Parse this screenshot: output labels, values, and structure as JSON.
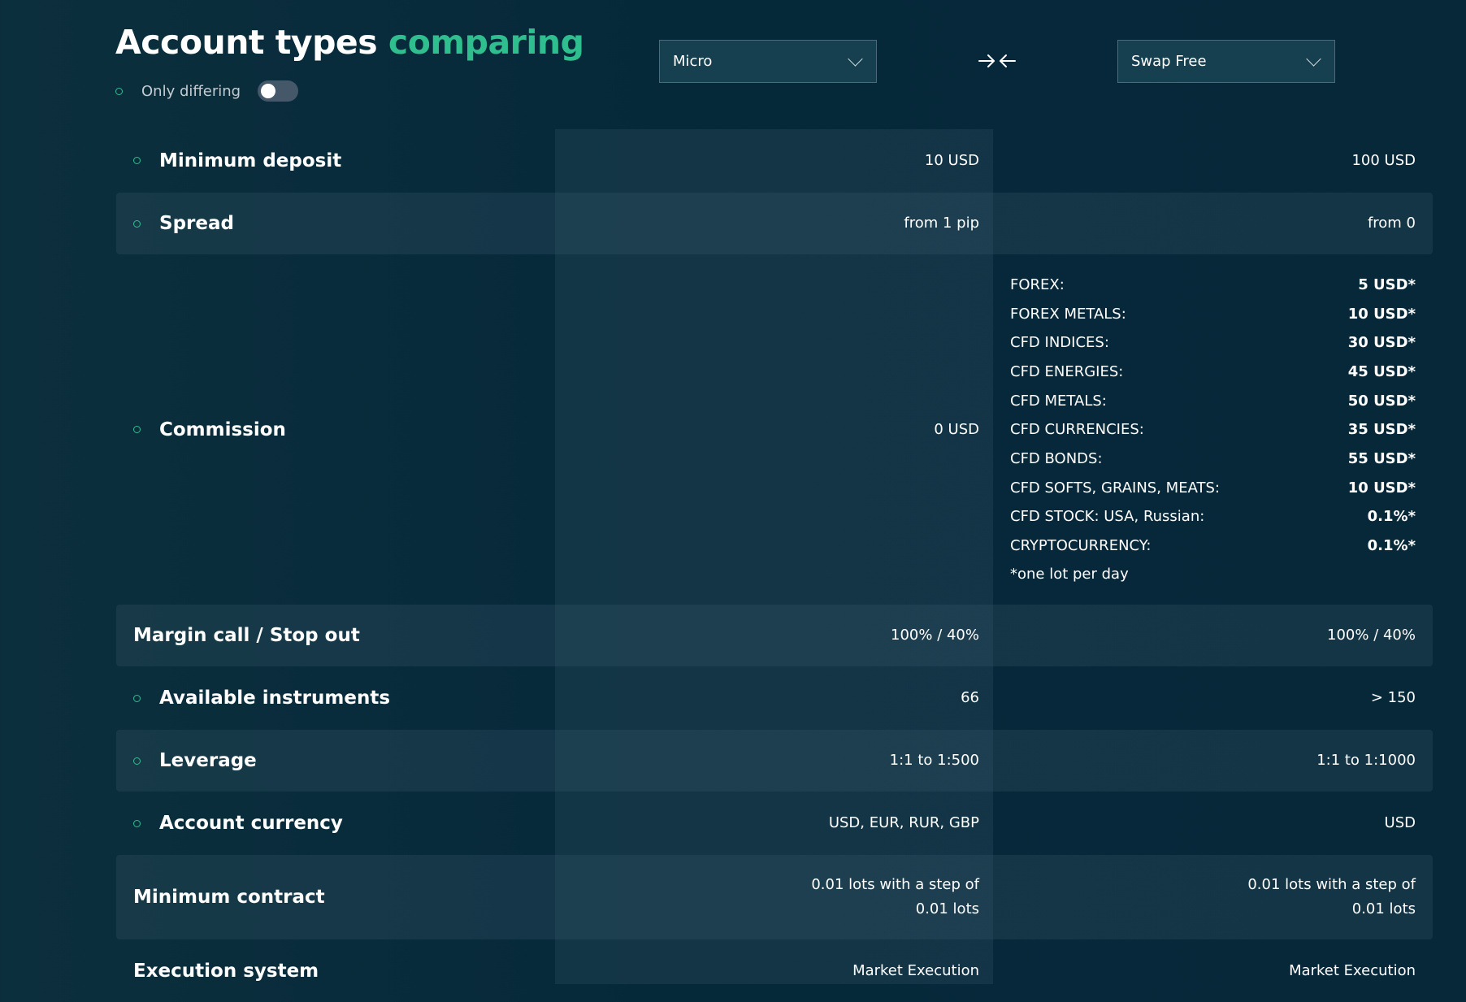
{
  "header": {
    "title_main": "Account types",
    "title_accent": "comparing",
    "only_differing_label": "Only differing",
    "only_differing_on": false,
    "accent_color": "#2fbf8f"
  },
  "selectors": {
    "left": {
      "value": "Micro"
    },
    "right": {
      "value": "Swap Free"
    },
    "swap_icon": "swap-arrows-icon"
  },
  "rows": [
    {
      "label": "Minimum deposit",
      "a": "10 USD",
      "b": "100 USD"
    },
    {
      "label": "Spread",
      "a": "from 1 pip",
      "b": "from 0"
    },
    {
      "label": "Commission",
      "a": "0 USD",
      "b": ""
    },
    {
      "label": "Margin call / Stop out",
      "a": "100% / 40%",
      "b": "100% / 40%"
    },
    {
      "label": "Available instruments",
      "a": "66",
      "b": "> 150"
    },
    {
      "label": "Leverage",
      "a": "1:1 to 1:500",
      "b": "1:1 to 1:1000"
    },
    {
      "label": "Account currency",
      "a": "USD, EUR, RUR, GBP",
      "b": "USD"
    },
    {
      "label": "Minimum contract",
      "a_line1": "0.01 lots with a step of",
      "a_line2": "0.01 lots",
      "b_line1": "0.01 lots with a step of",
      "b_line2": "0.01 lots"
    },
    {
      "label": "Execution system",
      "a": "Market Execution",
      "b": "Market Execution"
    }
  ],
  "commission_b": {
    "items": [
      {
        "name": "FOREX:",
        "value": "5 USD*"
      },
      {
        "name": "FOREX METALS:",
        "value": "10 USD*"
      },
      {
        "name": "CFD INDICES:",
        "value": "30 USD*"
      },
      {
        "name": "CFD ENERGIES:",
        "value": "45 USD*"
      },
      {
        "name": "CFD METALS:",
        "value": "50 USD*"
      },
      {
        "name": "CFD CURRENCIES:",
        "value": "35 USD*"
      },
      {
        "name": "CFD BONDS:",
        "value": "55 USD*"
      },
      {
        "name": "CFD SOFTS, GRAINS, MEATS:",
        "value": "10 USD*"
      },
      {
        "name": "CFD STOCK: USA, Russian:",
        "value": "0.1%*"
      },
      {
        "name": "CRYPTOCURRENCY:",
        "value": "0.1%*"
      }
    ],
    "note": "*one lot per day"
  }
}
